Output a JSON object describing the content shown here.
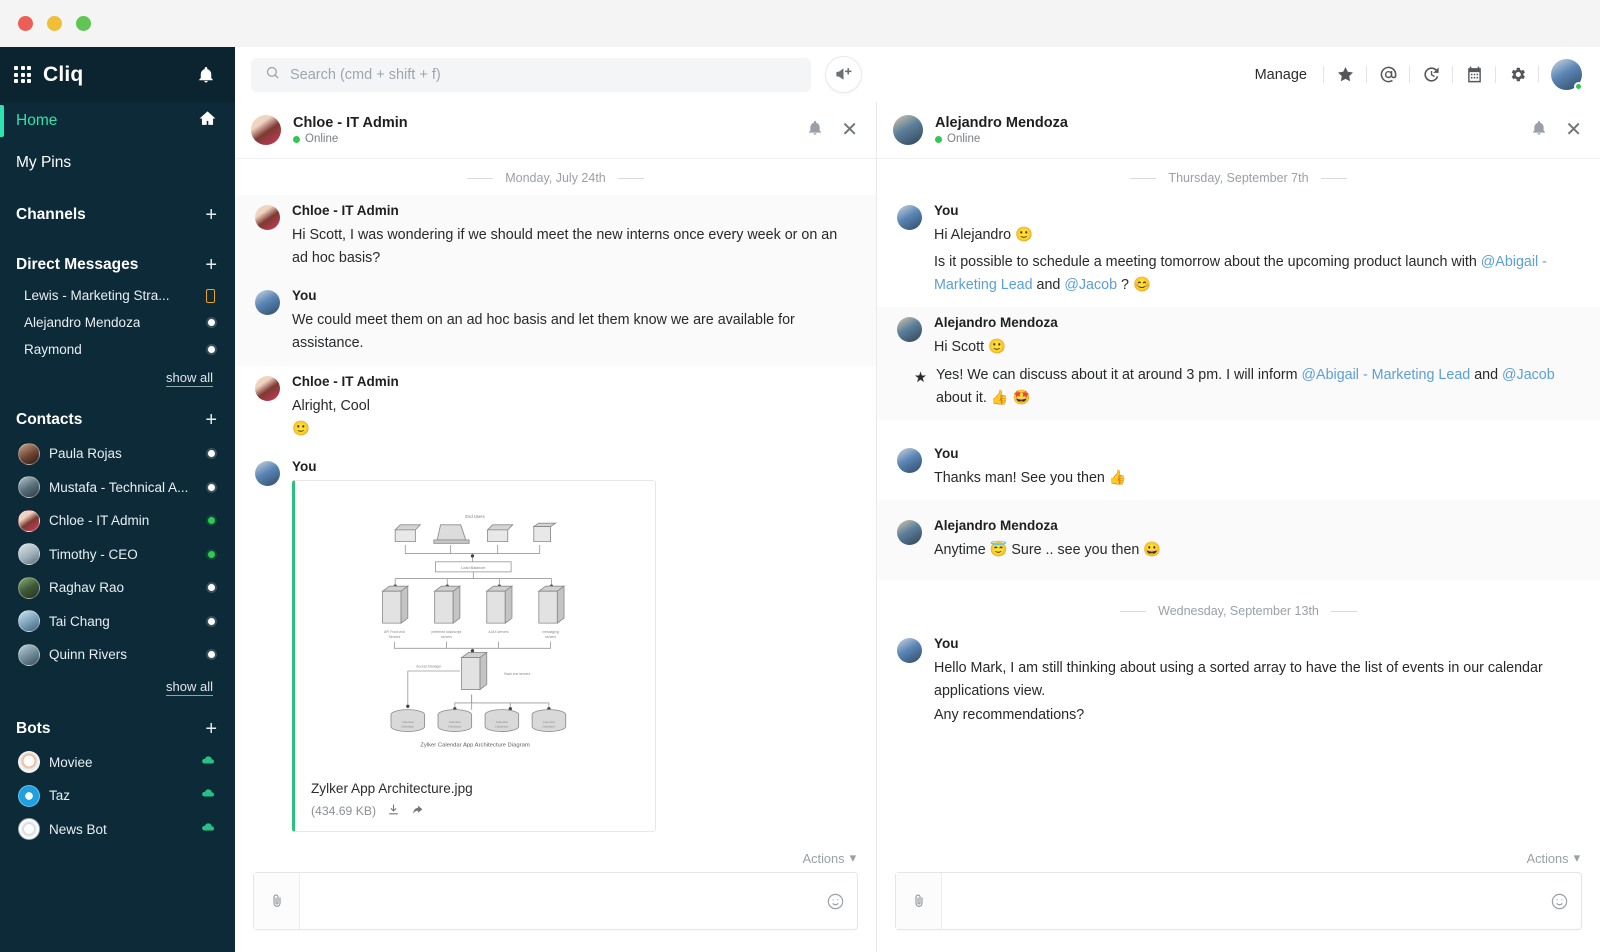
{
  "window": {
    "traffic_lights": [
      "close",
      "minimize",
      "maximize"
    ]
  },
  "sidebar": {
    "brand": "Cliq",
    "apps_icon": "grid-apps-icon",
    "notification_icon": "bell-icon",
    "nav": [
      {
        "label": "Home",
        "icon": "home-icon",
        "active": true
      },
      {
        "label": "My Pins",
        "icon": "",
        "active": false
      }
    ],
    "sections": [
      {
        "title": "Channels",
        "add_label": "+",
        "items": []
      },
      {
        "title": "Direct Messages",
        "add_label": "+",
        "items": [
          {
            "name": "Lewis - Marketing Stra...",
            "status": "mobile",
            "avatar": ""
          },
          {
            "name": "Alejandro Mendoza",
            "status": "away",
            "avatar": ""
          },
          {
            "name": "Raymond",
            "status": "away",
            "avatar": ""
          }
        ],
        "show_all": "show all"
      },
      {
        "title": "Contacts",
        "add_label": "+",
        "items": [
          {
            "name": "Paula Rojas",
            "status": "away",
            "avatar": "av-paula"
          },
          {
            "name": "Mustafa - Technical A...",
            "status": "away",
            "avatar": "av-mustafa"
          },
          {
            "name": "Chloe - IT Admin",
            "status": "online",
            "avatar": "av-chloe"
          },
          {
            "name": "Timothy - CEO",
            "status": "online",
            "avatar": "av-timothy"
          },
          {
            "name": "Raghav Rao",
            "status": "away",
            "avatar": "av-raghav"
          },
          {
            "name": "Tai Chang",
            "status": "away",
            "avatar": "av-tai"
          },
          {
            "name": "Quinn Rivers",
            "status": "away",
            "avatar": "av-quinn"
          }
        ],
        "show_all": "show all"
      },
      {
        "title": "Bots",
        "add_label": "+",
        "items": [
          {
            "name": "Moviee",
            "status": "cloud",
            "avatar": "av-moviee"
          },
          {
            "name": "Taz",
            "status": "cloud",
            "avatar": "av-taz"
          },
          {
            "name": "News Bot",
            "status": "cloud",
            "avatar": "av-newsbot"
          }
        ]
      }
    ]
  },
  "topbar": {
    "search_placeholder": "Search (cmd + shift + f)",
    "search_value": "",
    "search_icon": "search-icon",
    "announce_icon": "megaphone-plus-icon",
    "manage_label": "Manage",
    "icons": [
      "star-icon",
      "at-mention-icon",
      "history-icon",
      "calendar-icon",
      "gear-icon"
    ],
    "avatar_presence": "online"
  },
  "left_pane": {
    "header": {
      "name": "Chloe - IT Admin",
      "status": "Online",
      "bell_icon": "bell-icon",
      "close_icon": "close-icon"
    },
    "day_separator": "Monday, July 24th",
    "messages": [
      {
        "sender": "Chloe - IT Admin",
        "avatar": "av-chloe",
        "alt": true,
        "lines": [
          "Hi Scott, I was wondering if we should meet the new interns once every week or on an ad hoc basis?"
        ]
      },
      {
        "sender": "You",
        "avatar": "av-you",
        "alt": true,
        "lines": [
          "We could meet them on an ad hoc basis and let them know we are available for assistance."
        ]
      },
      {
        "sender": "Chloe - IT Admin",
        "avatar": "av-chloe",
        "alt": false,
        "lines": [
          "Alright, Cool",
          "🙂"
        ]
      },
      {
        "sender": "You",
        "avatar": "av-you",
        "alt": false,
        "attachment": {
          "filename": "Zylker App Architecture.jpg",
          "size": "(434.69 KB)",
          "caption": "Zylker Calendar App Architecture Diagram",
          "download_icon": "download-icon",
          "forward_icon": "forward-icon",
          "diagram_labels": {
            "top": "End Users",
            "switch": "Load Balancer",
            "tier2": [
              "API Web/Linux Servers",
              "preferred load/script servers",
              "AJAX servers",
              "messaging servers"
            ],
            "access": "Access Manager",
            "backend": "Back-end servers",
            "db": [
              "Calendar Database",
              "Calendar Database",
              "Calendar Database",
              "Calendar Database"
            ]
          }
        }
      }
    ],
    "actions_label": "Actions",
    "composer_placeholder": "",
    "attach_icon": "paperclip-icon",
    "emoji_icon": "smiley-icon"
  },
  "right_pane": {
    "header": {
      "name": "Alejandro Mendoza",
      "status": "Online",
      "bell_icon": "bell-icon",
      "close_icon": "close-icon"
    },
    "day_separator_1": "Thursday, September 7th",
    "day_separator_2": "Wednesday, September 13th",
    "messages": [
      {
        "sender": "You",
        "avatar": "av-you",
        "alt": false,
        "line1": "Hi Alejandro  🙂",
        "line2_a": "Is it possible to schedule a meeting tomorrow about the upcoming product launch with ",
        "mention1": "@Abigail - Marketing Lead",
        "mid": " and ",
        "mention2": "@Jacob",
        "line2_b": " ?  😊"
      },
      {
        "sender": "Alejandro Mendoza",
        "avatar": "av-alejandro",
        "alt": true,
        "line1": "Hi Scott  🙂",
        "starred": true,
        "line2_a": "Yes! We can discuss about it at around 3 pm. I will inform ",
        "mention1": "@Abigail - Marketing Lead",
        "mid": " and ",
        "mention2": "@Jacob",
        "line2_b": " about it. 👍 🤩"
      },
      {
        "sender": "You",
        "avatar": "av-you",
        "alt": false,
        "line1": "Thanks man! See you then 👍"
      },
      {
        "sender": "Alejandro Mendoza",
        "avatar": "av-alejandro",
        "alt": true,
        "line1": "Anytime 😇  Sure .. see you then  😀"
      },
      {
        "sender": "You",
        "avatar": "av-you",
        "alt": false,
        "line1": "Hello Mark, I am still thinking about using a sorted array to have the list of events in our calendar applications view.",
        "line2": "Any recommendations?"
      }
    ],
    "actions_label": "Actions",
    "composer_placeholder": "",
    "attach_icon": "paperclip-icon",
    "emoji_icon": "smiley-icon"
  },
  "colors": {
    "sidebar_bg": "#0d2a38",
    "accent_teal": "#2fe3ae",
    "online_green": "#2ec94f",
    "mention_blue": "#5b9fd8",
    "star_orange": "#f08c36",
    "attach_border_green": "#29c17e"
  }
}
